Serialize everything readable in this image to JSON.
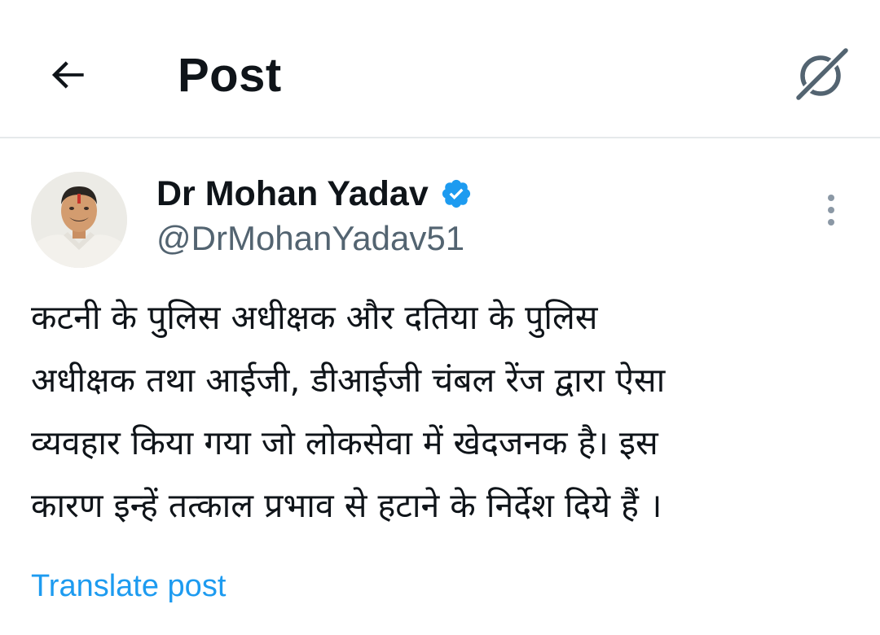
{
  "header": {
    "title": "Post",
    "back_icon": "arrow-left-icon",
    "grok_icon": "grok-icon"
  },
  "post": {
    "author": {
      "name": "Dr Mohan Yadav",
      "handle": "@DrMohanYadav51",
      "verified_icon": "verified-badge-icon",
      "verified_color": "#1d9bf0"
    },
    "more_icon": "more-vertical-icon",
    "text_lines": [
      "कटनी के पुलिस अधीक्षक और दतिया के पुलिस",
      "अधीक्षक तथा आईजी, डीआईजी चंबल रेंज द्वारा ऐसा",
      "व्यवहार किया गया जो लोकसेवा में खेदजनक है। इस",
      "कारण इन्हें तत्काल प्रभाव से हटाने के निर्देश दिये हैं ।"
    ],
    "translate_label": "Translate post"
  },
  "colors": {
    "text_primary": "#0f1419",
    "text_secondary": "#536471",
    "link": "#1d9bf0",
    "divider": "#e6e9eb"
  }
}
